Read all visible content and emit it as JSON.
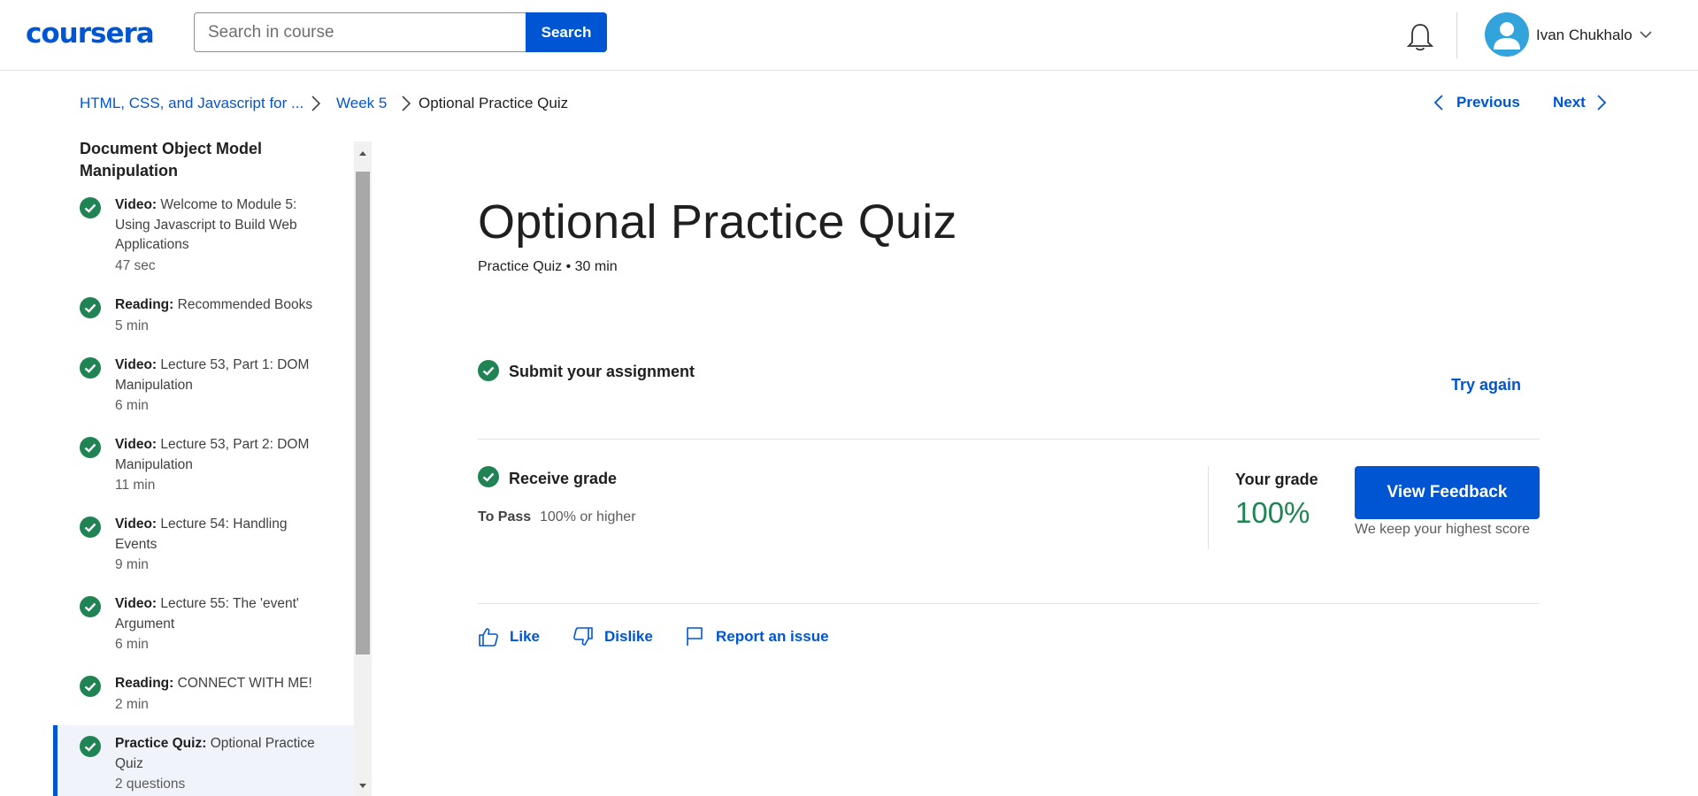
{
  "header": {
    "logo": "coursera",
    "search_placeholder": "Search in course",
    "search_button": "Search",
    "user_name": "Ivan Chukhalo"
  },
  "breadcrumb": {
    "course": "HTML, CSS, and Javascript for ...",
    "week": "Week 5",
    "current": "Optional Practice Quiz"
  },
  "nav": {
    "previous": "Previous",
    "next": "Next"
  },
  "sidebar": {
    "title": "Document Object Model Manipulation",
    "items": [
      {
        "type": "Video:",
        "name": "Welcome to Module 5: Using Javascript to Build Web Applications",
        "duration": "47 sec"
      },
      {
        "type": "Reading:",
        "name": "Recommended Books",
        "duration": "5 min"
      },
      {
        "type": "Video:",
        "name": "Lecture 53, Part 1: DOM Manipulation",
        "duration": "6 min"
      },
      {
        "type": "Video:",
        "name": "Lecture 53, Part 2: DOM Manipulation",
        "duration": "11 min"
      },
      {
        "type": "Video:",
        "name": "Lecture 54: Handling Events",
        "duration": "9 min"
      },
      {
        "type": "Video:",
        "name": "Lecture 55: The 'event' Argument",
        "duration": "6 min"
      },
      {
        "type": "Reading:",
        "name": "CONNECT WITH ME!",
        "duration": "2 min"
      },
      {
        "type": "Practice Quiz:",
        "name": "Optional Practice Quiz",
        "duration": "2 questions"
      }
    ]
  },
  "main": {
    "title": "Optional Practice Quiz",
    "subtitle": "Practice Quiz • 30 min",
    "submit_title": "Submit your assignment",
    "try_again": "Try again",
    "receive_title": "Receive grade",
    "to_pass_label": "To Pass",
    "to_pass_value": "100% or higher",
    "your_grade_label": "Your grade",
    "your_grade_value": "100%",
    "view_feedback": "View Feedback",
    "keep_score": "We keep your highest score",
    "like": "Like",
    "dislike": "Dislike",
    "report": "Report an issue"
  },
  "colors": {
    "brand": "#0056d2",
    "success": "#1f8354"
  }
}
